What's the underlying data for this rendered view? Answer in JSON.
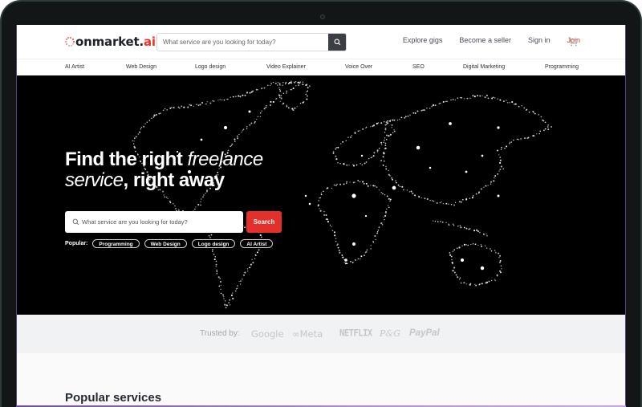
{
  "site": {
    "logo_prefix": "on",
    "logo_main": "market.",
    "logo_suffix": "ai",
    "brand_color": "#e8352c"
  },
  "header": {
    "search_placeholder": "What service are you looking for today?",
    "search_icon": "search-icon",
    "nav": [
      {
        "label": "Explore gigs"
      },
      {
        "label": "Become a seller"
      },
      {
        "label": "Sign in"
      },
      {
        "label": "Join"
      }
    ],
    "cart_icon": "cart-icon"
  },
  "categories": [
    {
      "label": "AI Artist"
    },
    {
      "label": "Web Design"
    },
    {
      "label": "Logo design"
    },
    {
      "label": "Video Explainer"
    },
    {
      "label": "Voice Over"
    },
    {
      "label": "SEO"
    },
    {
      "label": "Digital Marketing"
    },
    {
      "label": "Programming"
    }
  ],
  "hero": {
    "headline_bold_1": "Find the right ",
    "headline_italic_1": "freelance",
    "headline_italic_2": "service",
    "headline_bold_2": ", right away",
    "search_placeholder": "What service are you looking for today?",
    "search_button": "Search",
    "popular_label": "Popular:",
    "popular_tags": [
      {
        "label": "Programming"
      },
      {
        "label": "Web Design"
      },
      {
        "label": "Logo design"
      },
      {
        "label": "AI Artist"
      }
    ]
  },
  "trusted": {
    "label": "Trusted by:",
    "brands": [
      {
        "name": "Google"
      },
      {
        "name": "Meta"
      },
      {
        "name": "NETFLIX"
      },
      {
        "name": "P&G"
      },
      {
        "name": "PayPal"
      }
    ]
  },
  "sections": {
    "popular_services_title": "Popular services"
  },
  "colors": {
    "accent": "#e3302a",
    "hero_bg": "#000000",
    "trusted_bg": "#f1f2f4",
    "page_bg": "#fafafa"
  }
}
